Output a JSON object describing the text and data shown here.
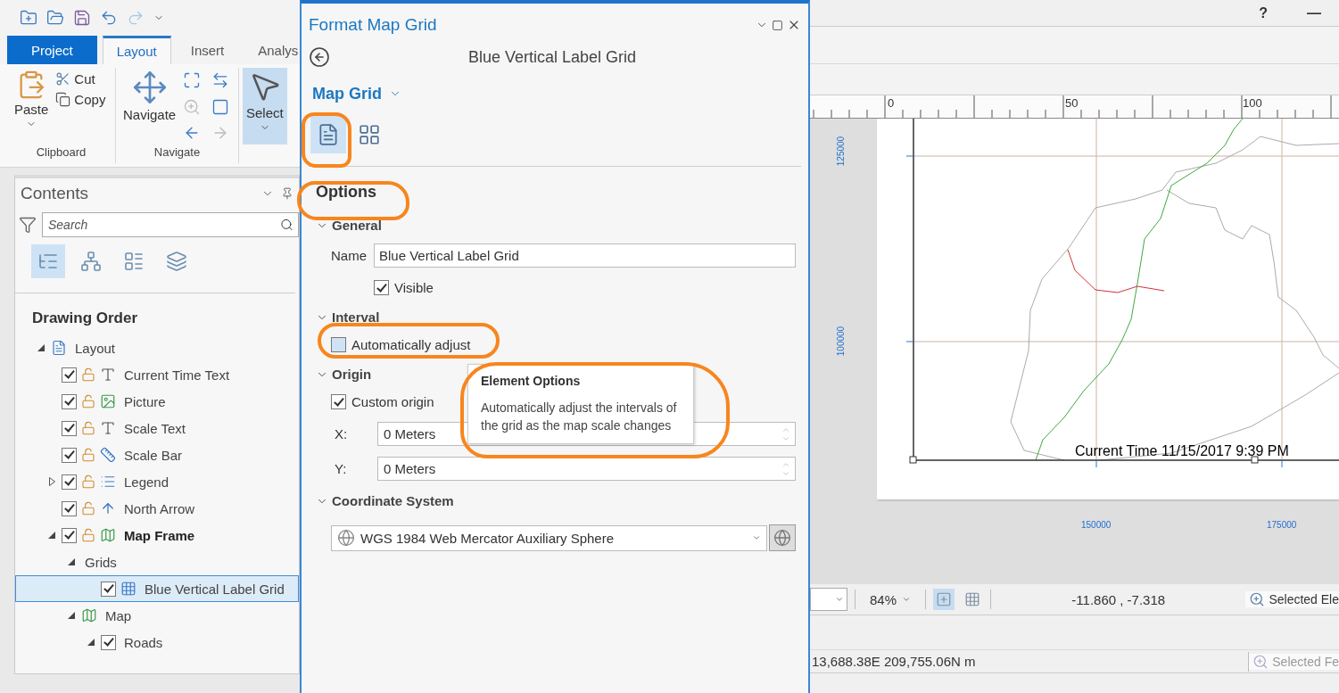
{
  "window": {
    "help": "?",
    "minimize": "—"
  },
  "ribbon": {
    "tabs": [
      {
        "label": "Project",
        "kind": "backstage",
        "selected": false
      },
      {
        "label": "Layout",
        "kind": "normal",
        "selected": true
      },
      {
        "label": "Insert",
        "kind": "normal",
        "selected": false
      },
      {
        "label": "Analys",
        "kind": "normal",
        "selected": false
      }
    ],
    "groups": [
      {
        "kind": "clipboard",
        "label": "Clipboard",
        "large": "Paste",
        "small": [
          "Cut",
          "Copy"
        ]
      },
      {
        "kind": "navigate",
        "label": "Navigate",
        "large": "Navigate"
      },
      {
        "kind": "selection",
        "large": "Select",
        "selected": true
      }
    ]
  },
  "contents": {
    "title": "Contents",
    "search": {
      "placeholder": "Search"
    },
    "views": [
      {
        "kind": "order",
        "selected": true
      },
      {
        "kind": "list",
        "selected": false
      },
      {
        "kind": "selection",
        "selected": false
      },
      {
        "kind": "pages",
        "selected": false
      }
    ],
    "heading": "Drawing Order",
    "tree": [
      {
        "label": "Layout",
        "kind": "layout",
        "expanded": true,
        "selected": false,
        "children": [
          {
            "label": "Current Time Text",
            "kind": "text",
            "checked": true,
            "locked": false,
            "active": false,
            "selected": false
          },
          {
            "label": "Picture",
            "kind": "picture",
            "checked": true,
            "locked": false,
            "active": false,
            "selected": false
          },
          {
            "label": "Scale Text",
            "kind": "text",
            "checked": true,
            "locked": false,
            "active": false,
            "selected": false
          },
          {
            "label": "Scale Bar",
            "kind": "scalebar",
            "checked": true,
            "locked": false,
            "active": false,
            "selected": false
          },
          {
            "label": "Legend",
            "kind": "legend",
            "expanded": false,
            "checked": true,
            "locked": false,
            "active": false,
            "selected": false
          },
          {
            "label": "North Arrow",
            "kind": "north",
            "checked": true,
            "locked": false,
            "active": false,
            "selected": false
          },
          {
            "label": "Map Frame",
            "kind": "mapframe",
            "expanded": true,
            "checked": true,
            "locked": false,
            "active": true,
            "selected": false,
            "children": [
              {
                "label": "Grids",
                "kind": "group",
                "expanded": true,
                "selected": false,
                "children": [
                  {
                    "label": "Blue Vertical Label Grid",
                    "kind": "grid",
                    "checked": true,
                    "selected": true
                  }
                ]
              },
              {
                "label": "Map",
                "kind": "map",
                "expanded": true,
                "selected": false,
                "children": [
                  {
                    "label": "Roads",
                    "kind": "layer",
                    "expanded": true,
                    "checked": true,
                    "selected": false
                  }
                ]
              }
            ]
          }
        ]
      }
    ]
  },
  "format_pane": {
    "title": "Format Map Grid",
    "element": "Blue Vertical Label Grid",
    "element_type": "Map Grid",
    "tabs": [
      {
        "kind": "options",
        "selected": true
      },
      {
        "kind": "display",
        "selected": false
      }
    ],
    "section": "Options",
    "groups": [
      {
        "title": "General",
        "expanded": true,
        "rows": [
          {
            "kind": "text",
            "label": "Name",
            "value": "Blue Vertical Label Grid"
          },
          {
            "kind": "checkbox",
            "label": "Visible",
            "checked": true
          }
        ]
      },
      {
        "title": "Interval",
        "expanded": true,
        "rows": [
          {
            "kind": "checkbox",
            "label": "Automatically adjust",
            "checked": false
          }
        ]
      },
      {
        "title": "Origin",
        "expanded": true,
        "rows": [
          {
            "kind": "checkbox",
            "label": "Custom origin",
            "checked": true
          },
          {
            "kind": "number",
            "label": "X:",
            "value": "0 Meters"
          },
          {
            "kind": "number",
            "label": "Y:",
            "value": "0 Meters"
          }
        ]
      },
      {
        "title": "Coordinate System",
        "expanded": true,
        "rows": [
          {
            "kind": "dropdown",
            "value": "WGS 1984 Web Mercator Auxiliary Sphere"
          }
        ]
      }
    ],
    "tooltip": {
      "title": "Element Options",
      "text": "Automatically adjust the intervals of the grid as the map scale changes"
    }
  },
  "layout_view": {
    "ruler": [
      "0",
      "50",
      "100"
    ],
    "left_labels": [
      "125000",
      "100000"
    ],
    "bottom_labels": [
      "150000",
      "175000"
    ],
    "text_element": "Current Time 11/15/2017 9:39 PM"
  },
  "status_bar": {
    "zoom": "84%",
    "toggles": [
      {
        "kind": "guides",
        "selected": true
      },
      {
        "kind": "grid",
        "selected": false
      }
    ],
    "coordinates": "-11.860 , -7.318",
    "selection": "Selected Ele"
  },
  "bottom_bar": {
    "coordinates": "13,688.38E 209,755.06N m",
    "selection": "Selected Fe"
  }
}
